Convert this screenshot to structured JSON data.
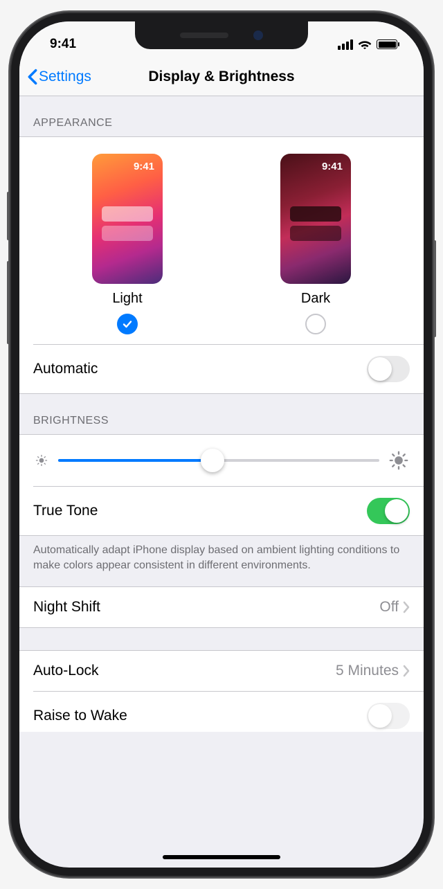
{
  "status": {
    "time": "9:41"
  },
  "nav": {
    "back_label": "Settings",
    "title": "Display & Brightness"
  },
  "appearance": {
    "header": "APPEARANCE",
    "thumb_time": "9:41",
    "light_label": "Light",
    "dark_label": "Dark",
    "selected": "light",
    "automatic_label": "Automatic",
    "automatic_on": false
  },
  "brightness": {
    "header": "BRIGHTNESS",
    "value_percent": 48,
    "true_tone_label": "True Tone",
    "true_tone_on": true,
    "footer": "Automatically adapt iPhone display based on ambient lighting conditions to make colors appear consistent in different environments."
  },
  "night_shift": {
    "label": "Night Shift",
    "value": "Off"
  },
  "auto_lock": {
    "label": "Auto-Lock",
    "value": "5 Minutes"
  },
  "raise_to_wake": {
    "label": "Raise to Wake"
  }
}
